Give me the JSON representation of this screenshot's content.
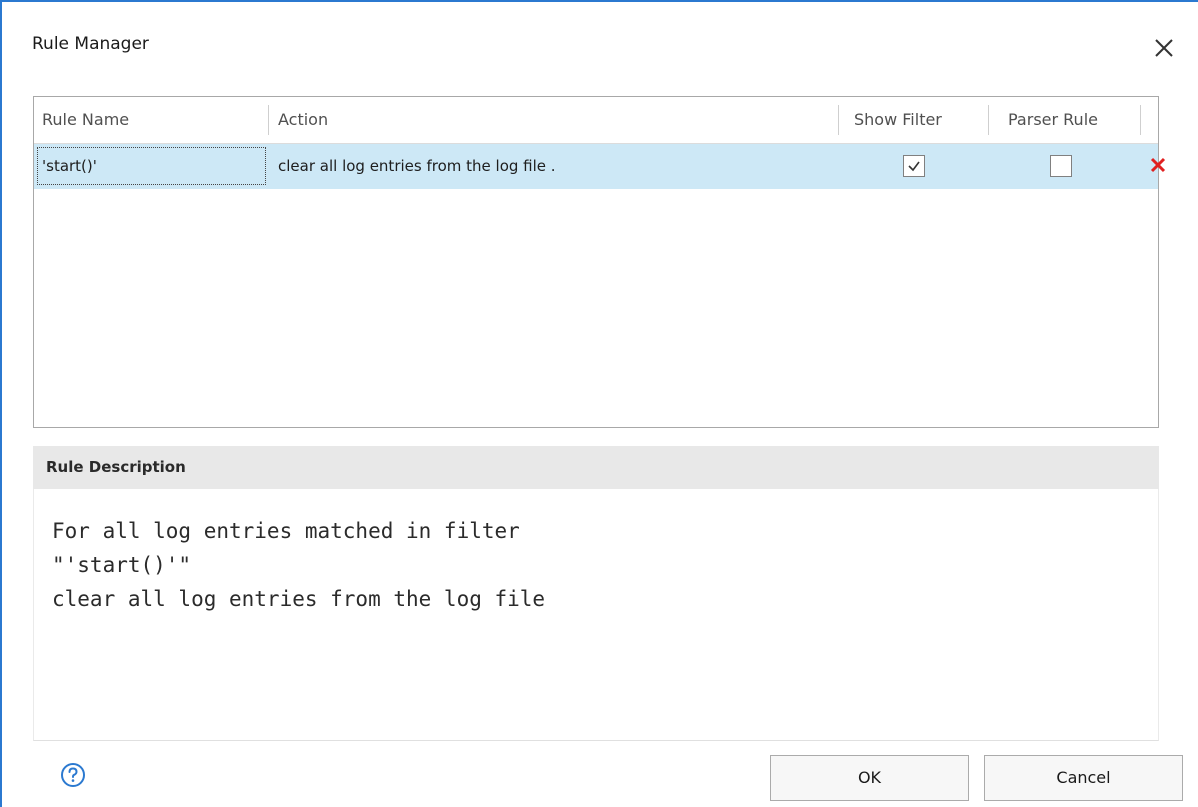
{
  "dialog": {
    "title": "Rule Manager",
    "accent_color": "#2b79d0"
  },
  "grid": {
    "columns": [
      "Rule Name",
      "Action",
      "Show Filter",
      "Parser Rule"
    ],
    "rows": [
      {
        "rule_name": "'start()'",
        "action": "clear all log entries from the log file .",
        "show_filter": true,
        "parser_rule": false,
        "delete_icon": "red-x-icon"
      }
    ],
    "selected_row_color": "#cde8f6"
  },
  "description": {
    "header": "Rule Description",
    "lines": [
      "For all log entries matched in filter",
      "\"'start()'\"",
      "clear all log entries from the log file"
    ]
  },
  "footer": {
    "help_icon": "question-circle-icon",
    "ok_label": "OK",
    "cancel_label": "Cancel"
  }
}
